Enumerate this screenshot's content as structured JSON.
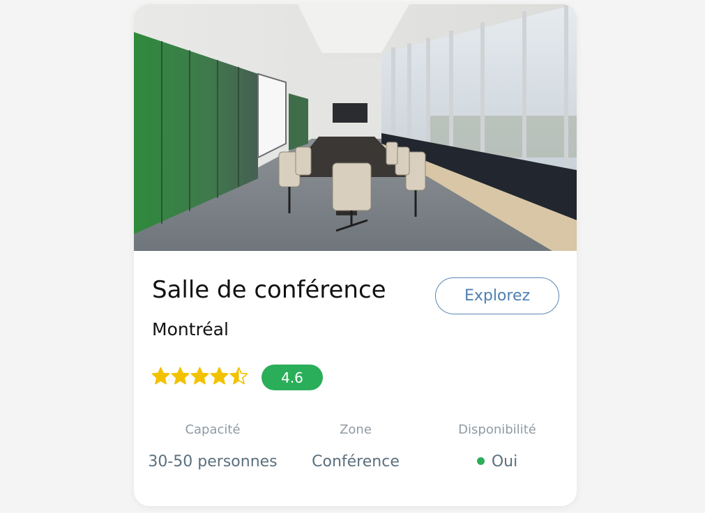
{
  "venue": {
    "title": "Salle de conférence",
    "city": "Montréal",
    "explore_label": "Explorez",
    "rating": 4.6,
    "rating_label": "4.6",
    "rating_max": 5
  },
  "stats": [
    {
      "label": "Capacité",
      "value": "30-50 personnes"
    },
    {
      "label": "Zone",
      "value": "Conférence"
    },
    {
      "label": "Disponibilité",
      "value": "Oui",
      "status": "available"
    }
  ],
  "colors": {
    "accent": "#4e7fb0",
    "rating_green": "#2bae5a",
    "star": "#f2c200"
  },
  "image": {
    "subject": "conference-room-photo"
  }
}
